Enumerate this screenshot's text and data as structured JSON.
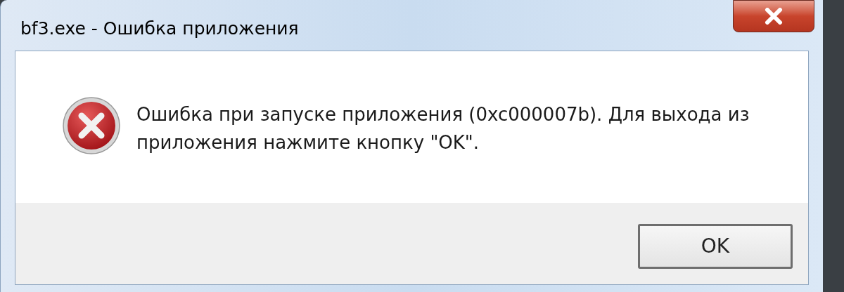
{
  "window": {
    "title": "bf3.exe - Ошибка приложения"
  },
  "message": "Ошибка при запуске приложения (0xc000007b). Для выхода из приложения нажмите кнопку \"OK\".",
  "buttons": [
    {
      "label": "OK"
    }
  ]
}
